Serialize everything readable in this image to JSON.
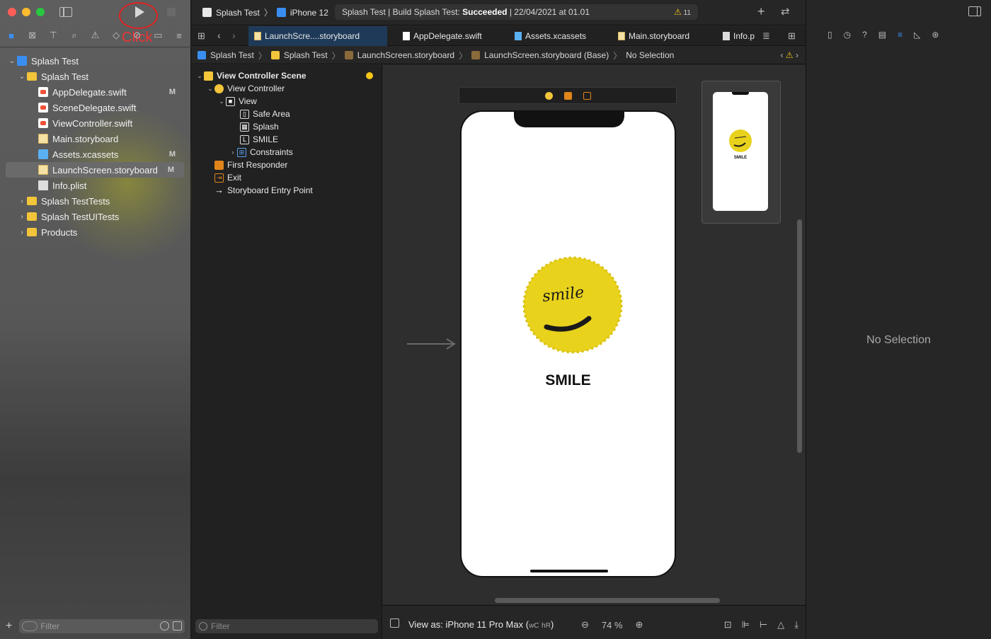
{
  "window": {
    "annotation": "Click",
    "colors": {
      "close": "#ff5f57",
      "minimize": "#febc2e",
      "zoom": "#28c840",
      "accent": "#3a8ef0",
      "selected_tab": "#1f3a59",
      "smile_yellow": "#e8d21c"
    }
  },
  "toolbar": {
    "scheme_project": "Splash Test",
    "scheme_device": "iPhone 12",
    "activity_prefix": "Splash Test | Build Splash Test: ",
    "activity_status": "Succeeded",
    "activity_suffix": " | 22/04/2021 at 01.01",
    "warning_count": "11",
    "add_icon": "plus-icon",
    "layout_icon": "swap-arrows-icon"
  },
  "navigator": {
    "tree": [
      {
        "label": "Splash Test",
        "level": 0,
        "type": "project",
        "expanded": true,
        "badge": ""
      },
      {
        "label": "Splash Test",
        "level": 1,
        "type": "folder",
        "expanded": true,
        "badge": ""
      },
      {
        "label": "AppDelegate.swift",
        "level": 2,
        "type": "swift",
        "badge": "M"
      },
      {
        "label": "SceneDelegate.swift",
        "level": 2,
        "type": "swift",
        "badge": ""
      },
      {
        "label": "ViewController.swift",
        "level": 2,
        "type": "swift",
        "badge": ""
      },
      {
        "label": "Main.storyboard",
        "level": 2,
        "type": "storyboard",
        "badge": ""
      },
      {
        "label": "Assets.xcassets",
        "level": 2,
        "type": "assets",
        "badge": "M"
      },
      {
        "label": "LaunchScreen.storyboard",
        "level": 2,
        "type": "storyboard",
        "badge": "M",
        "selected": true
      },
      {
        "label": "Info.plist",
        "level": 2,
        "type": "plist",
        "badge": ""
      },
      {
        "label": "Splash TestTests",
        "level": 1,
        "type": "folder",
        "expanded": false,
        "badge": ""
      },
      {
        "label": "Splash TestUITests",
        "level": 1,
        "type": "folder",
        "expanded": false,
        "badge": ""
      },
      {
        "label": "Products",
        "level": 1,
        "type": "folder",
        "expanded": false,
        "badge": ""
      }
    ],
    "filter_placeholder": "Filter"
  },
  "tabs": [
    {
      "label": "LaunchScre....storyboard",
      "active": true
    },
    {
      "label": "AppDelegate.swift",
      "active": false
    },
    {
      "label": "Assets.xcassets",
      "active": false
    },
    {
      "label": "Main.storyboard",
      "active": false
    },
    {
      "label": "Info.p",
      "active": false
    }
  ],
  "jumpbar": {
    "crumbs": [
      "Splash Test",
      "Splash Test",
      "LaunchScreen.storyboard",
      "LaunchScreen.storyboard (Base)",
      "No Selection"
    ]
  },
  "outline": {
    "rows": [
      {
        "label": "View Controller Scene",
        "level": 0,
        "disclosure": "open",
        "icon": "V",
        "bold": true
      },
      {
        "label": "View Controller",
        "level": 1,
        "disclosure": "open",
        "icon": "○"
      },
      {
        "label": "View",
        "level": 2,
        "disclosure": "open",
        "icon": "■"
      },
      {
        "label": "Safe Area",
        "level": 3,
        "disclosure": "",
        "icon": "▯"
      },
      {
        "label": "Splash",
        "level": 3,
        "disclosure": "",
        "icon": "▦"
      },
      {
        "label": "SMILE",
        "level": 3,
        "disclosure": "",
        "icon": "L"
      },
      {
        "label": "Constraints",
        "level": 3,
        "disclosure": "closed",
        "icon": "⊞"
      },
      {
        "label": "First Responder",
        "level": 1,
        "disclosure": "",
        "icon": "⬡"
      },
      {
        "label": "Exit",
        "level": 1,
        "disclosure": "",
        "icon": "⇥"
      },
      {
        "label": "Storyboard Entry Point",
        "level": 1,
        "disclosure": "",
        "icon": "→"
      }
    ],
    "filter_placeholder": "Filter"
  },
  "canvas": {
    "smile_text": "smile",
    "label_text": "SMILE"
  },
  "bottombar": {
    "view_as": "View as: iPhone 11 Pro Max (",
    "size_class_w": "wC",
    "size_class_h": "hR",
    "close_paren": ")",
    "zoom_level": "74 %"
  },
  "inspector": {
    "empty_text": "No Selection"
  }
}
